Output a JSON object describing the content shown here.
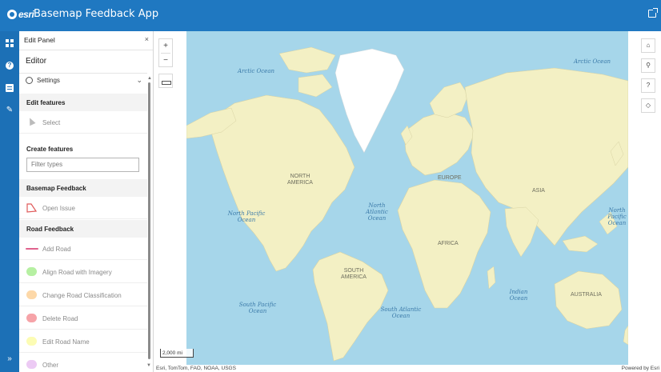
{
  "header": {
    "brand": "esri",
    "title": "Basemap Feedback App"
  },
  "panel": {
    "title": "Edit Panel",
    "close_glyph": "×",
    "editor_heading": "Editor",
    "settings_label": "Settings",
    "edit_features_heading": "Edit features",
    "select_label": "Select",
    "create_features_heading": "Create features",
    "filter_placeholder": "Filter types",
    "groups": [
      {
        "heading": "Basemap Feedback",
        "items": [
          {
            "label": "Open Issue",
            "symbol": "polygon-outline",
            "color": "#e05a5a"
          }
        ]
      },
      {
        "heading": "Road Feedback",
        "items": [
          {
            "label": "Add Road",
            "symbol": "line",
            "color": "#e0628d"
          },
          {
            "label": "Align Road with Imagery",
            "symbol": "fill",
            "color": "#b6f0a2"
          },
          {
            "label": "Change Road Classification",
            "symbol": "fill",
            "color": "#fdd8a8"
          },
          {
            "label": "Delete Road",
            "symbol": "fill",
            "color": "#f6a3a8"
          },
          {
            "label": "Edit Road Name",
            "symbol": "fill",
            "color": "#fcfcb4"
          },
          {
            "label": "Other",
            "symbol": "fill",
            "color": "#eccaf4"
          }
        ]
      }
    ]
  },
  "map": {
    "zoom_in": "+",
    "zoom_out": "−",
    "scale": "2,000 mi",
    "attribution_left": "Esri, TomTom, FAO, NOAA, USGS",
    "attribution_right": "Powered by Esri",
    "ocean_labels": [
      "Arctic Ocean",
      "Arctic Ocean",
      "North Atlantic Ocean",
      "North Pacific Ocean",
      "North Pacific Ocean",
      "South Pacific Ocean",
      "South Atlantic Ocean",
      "Indian Ocean"
    ],
    "land_labels": [
      "NORTH AMERICA",
      "EUROPE",
      "ASIA",
      "AFRICA",
      "SOUTH AMERICA",
      "AUSTRALIA"
    ]
  },
  "colors": {
    "header": "#1f78c1",
    "rail": "#1c70b6",
    "ocean": "#a6d6ea",
    "land": "#f3f0c4"
  }
}
